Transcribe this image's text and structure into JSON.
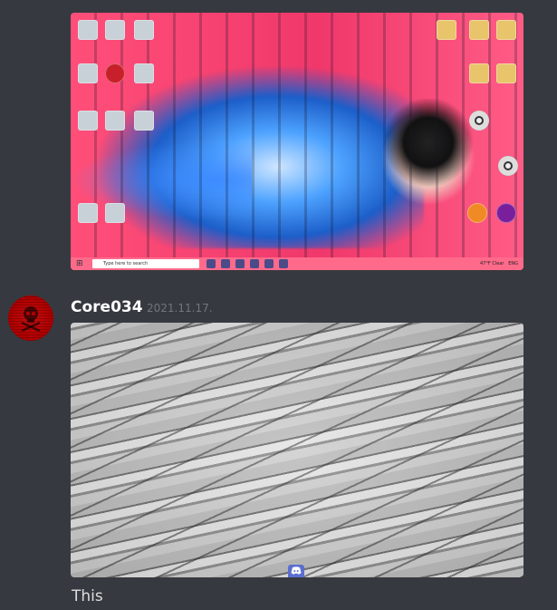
{
  "previous_message": {
    "attachment": {
      "type": "desktop-screenshot",
      "taskbar": {
        "search_placeholder": "Type here to search",
        "tray_weather": "47°F Clear",
        "tray_lang": "ENG"
      }
    }
  },
  "message": {
    "username": "Core034",
    "timestamp": "2021.11.17.",
    "attachment": {
      "type": "image",
      "description_icon": "discord-logo-icon"
    },
    "text": "This"
  },
  "colors": {
    "background": "#36393f",
    "username": "#ffffff",
    "timestamp": "#72767d",
    "message_text": "#dcddde",
    "avatar": "#b00000"
  }
}
